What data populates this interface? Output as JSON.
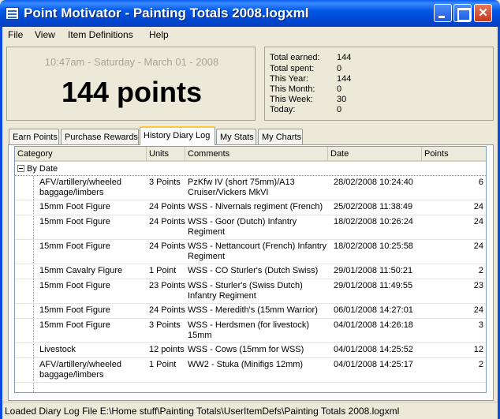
{
  "window": {
    "title": "Point Motivator - Painting Totals 2008.logxml"
  },
  "menu": [
    "File",
    "View",
    "Item Definitions",
    "Help"
  ],
  "summary": {
    "datetime": "10:47am - Saturday - March 01 - 2008",
    "points": "144 points"
  },
  "stats": [
    {
      "label": "Total earned:",
      "value": "144"
    },
    {
      "label": "Total spent:",
      "value": "0"
    },
    {
      "label": "This Year:",
      "value": "144"
    },
    {
      "label": "This Month:",
      "value": "0"
    },
    {
      "label": "This Week:",
      "value": "30"
    },
    {
      "label": "Today:",
      "value": "0"
    }
  ],
  "tabs": [
    "Earn Points",
    "Purchase Rewards",
    "History Diary Log",
    "My Stats",
    "My Charts"
  ],
  "active_tab": "History Diary Log",
  "grid": {
    "columns": [
      "Category",
      "Units",
      "Comments",
      "Date",
      "Points"
    ],
    "group": "By Date",
    "rows": [
      {
        "category": "AFV/artillery/wheeled baggage/limbers",
        "units": "3 Points",
        "comments": "PzKfw IV (short 75mm)/A13 Cruiser/Vickers MkVI",
        "date": "28/02/2008 10:24:40",
        "points": "6"
      },
      {
        "category": "15mm Foot Figure",
        "units": "24 Points",
        "comments": "WSS - Nivernais regiment (French)",
        "date": "25/02/2008 11:38:49",
        "points": "24"
      },
      {
        "category": "15mm Foot Figure",
        "units": "24 Points",
        "comments": "WSS - Goor (Dutch) Infantry Regiment",
        "date": "18/02/2008 10:26:24",
        "points": "24"
      },
      {
        "category": "15mm Foot Figure",
        "units": "24 Points",
        "comments": "WSS - Nettancourt (French) Infantry Regiment",
        "date": "18/02/2008 10:25:58",
        "points": "24"
      },
      {
        "category": "15mm Cavalry Figure",
        "units": "1 Point",
        "comments": "WSS - CO Sturler's (Dutch Swiss)",
        "date": "29/01/2008 11:50:21",
        "points": "2"
      },
      {
        "category": "15mm Foot Figure",
        "units": "23 Points",
        "comments": "WSS - Sturler's (Swiss Dutch) Infantry Regiment",
        "date": "29/01/2008 11:49:55",
        "points": "23"
      },
      {
        "category": "15mm Foot Figure",
        "units": "24 Points",
        "comments": "WSS - Meredith's (15mm Warrior)",
        "date": "06/01/2008 14:27:01",
        "points": "24"
      },
      {
        "category": "15mm Foot Figure",
        "units": "3 Points",
        "comments": "WSS - Herdsmen (for livestock) 15mm",
        "date": "04/01/2008 14:26:18",
        "points": "3"
      },
      {
        "category": "Livestock",
        "units": "12 points",
        "comments": "WSS - Cows (15mm for WSS)",
        "date": "04/01/2008 14:25:52",
        "points": "12"
      },
      {
        "category": "AFV/artillery/wheeled baggage/limbers",
        "units": "1 Point",
        "comments": "WW2 - Stuka (Minifigs 12mm)",
        "date": "04/01/2008 14:25:17",
        "points": "2"
      }
    ]
  },
  "status": "Loaded Diary Log File E:\\Home stuff\\Painting Totals\\UserItemDefs\\Painting Totals 2008.logxml",
  "colors": {
    "titlebar": "#0058e6",
    "active_tab_accent": "#ffc83c",
    "dim_text": "#a8a594"
  }
}
